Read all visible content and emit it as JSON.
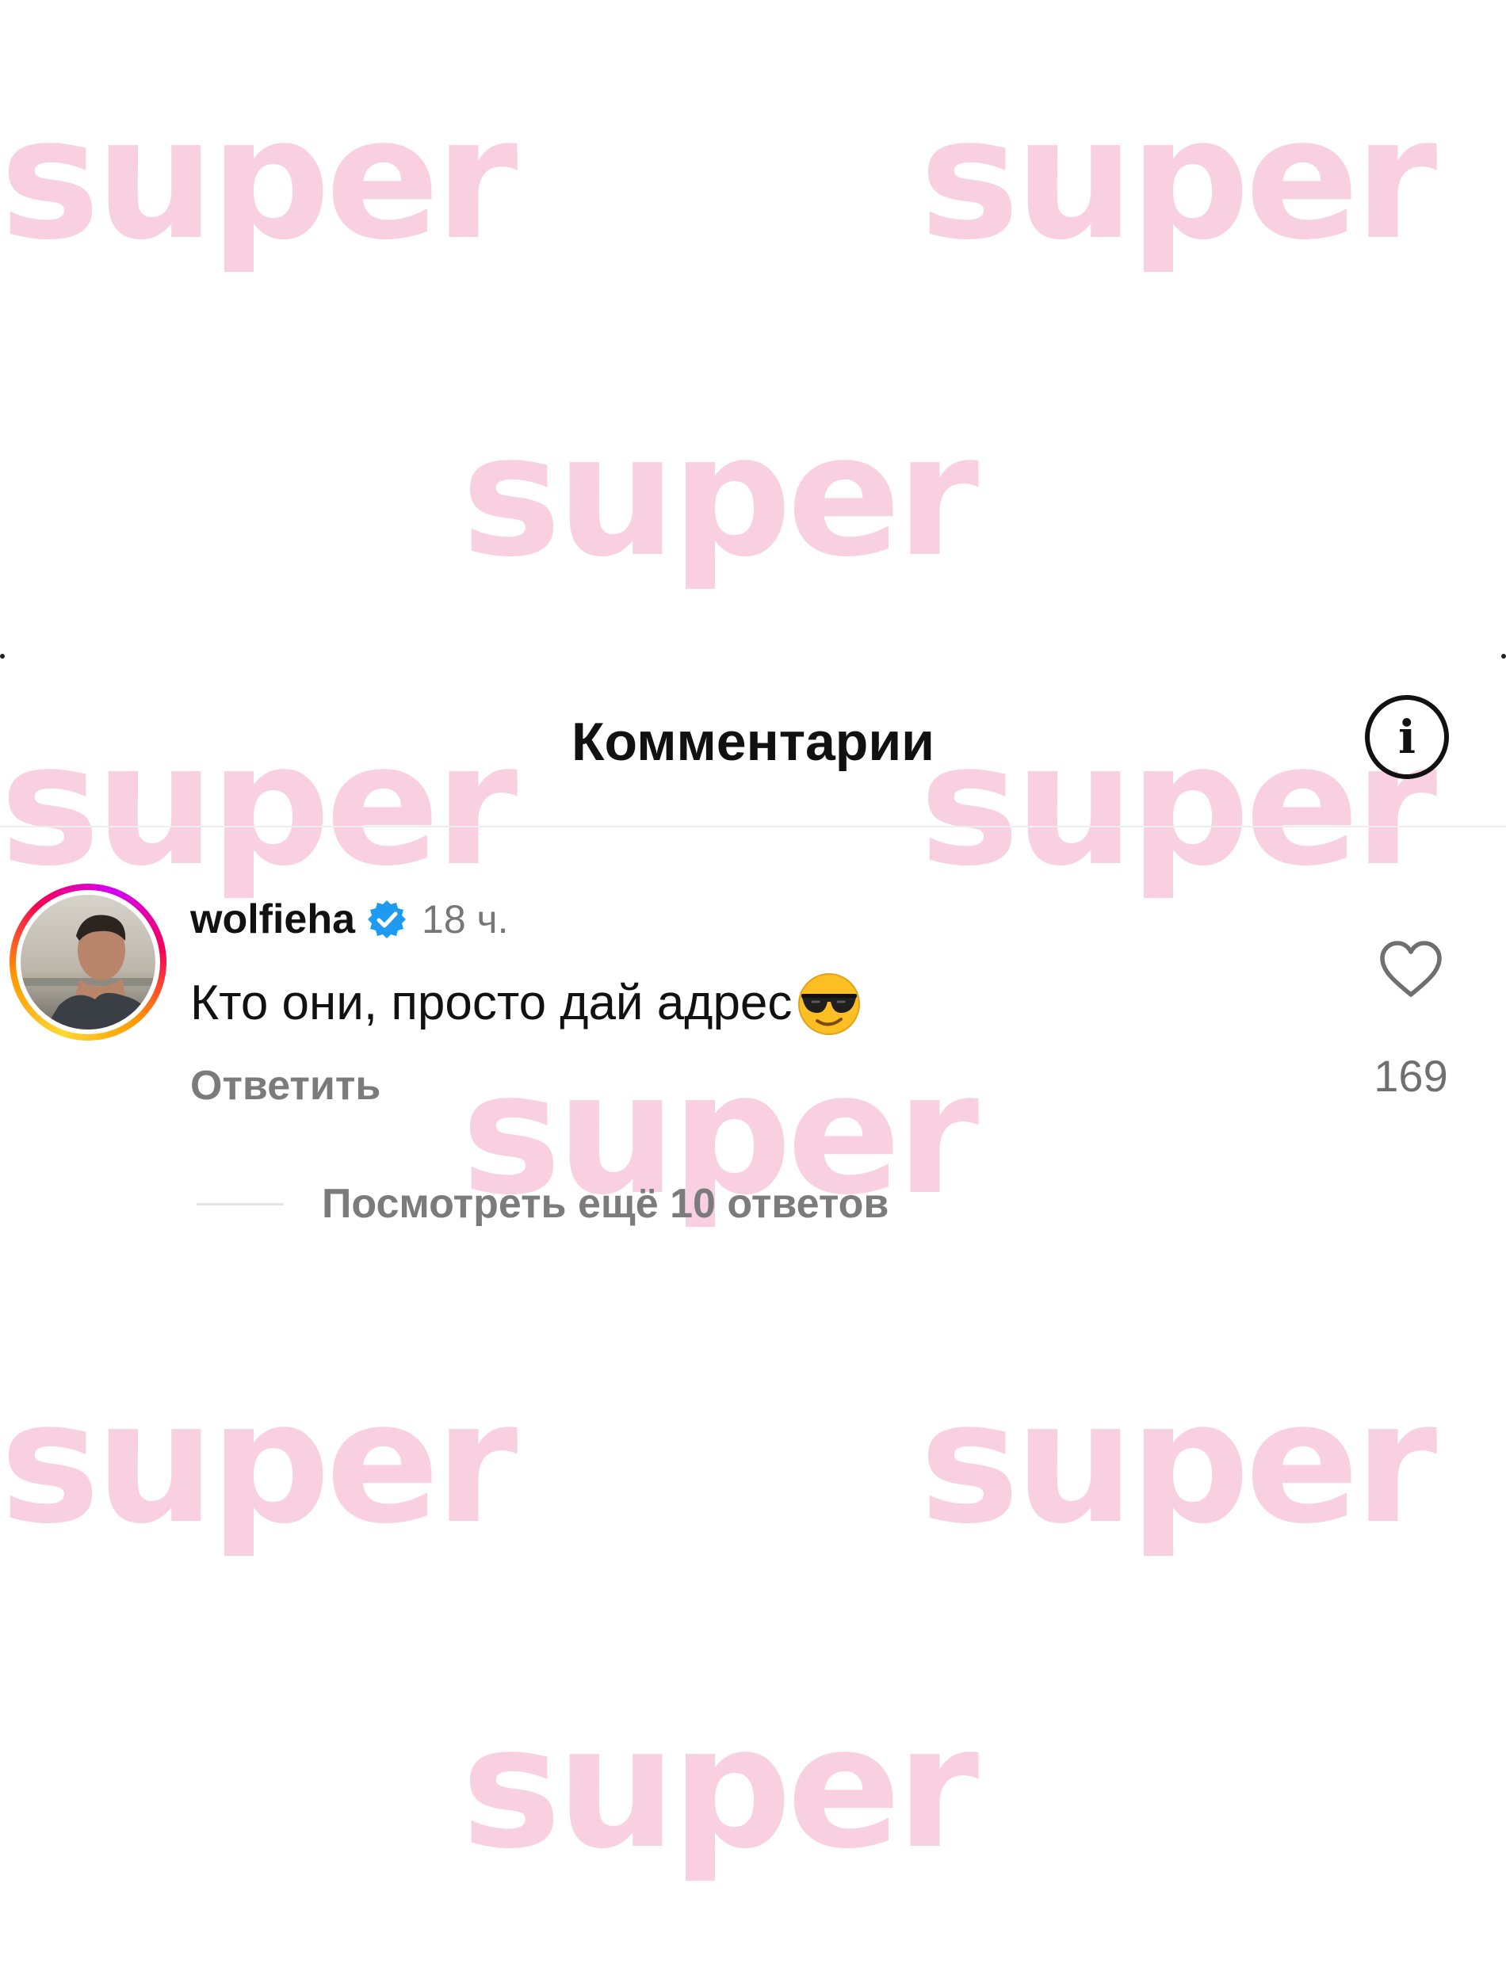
{
  "watermark": {
    "text": "super",
    "color": "#f8c6d8"
  },
  "header": {
    "title": "Комментарии",
    "info_icon": "info-circle-icon"
  },
  "comment": {
    "username": "wolfieha",
    "verified_icon": "verified-badge-icon",
    "time": "18 ч.",
    "text": "Кто они, просто дай адрес",
    "emoji_icon": "sunglasses-emoji-icon",
    "reply_label": "Ответить",
    "like_icon": "heart-outline-icon",
    "like_count": "169",
    "more_replies_label": "Посмотреть ещё 10 ответов"
  },
  "colors": {
    "verified": "#1d9bf0",
    "text_primary": "#111111",
    "text_secondary": "#7b7b7b"
  }
}
